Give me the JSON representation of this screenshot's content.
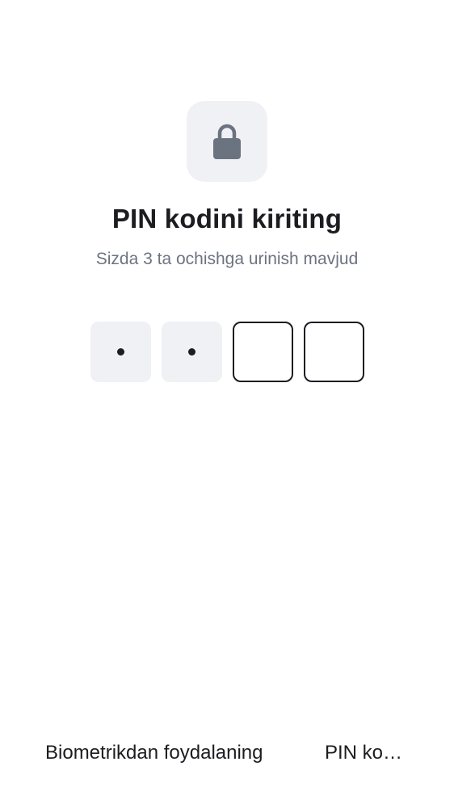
{
  "header": {
    "lock_icon": "lock-icon",
    "title": "PIN kodini kiriting",
    "subtitle": "Sizda 3 ta ochishga urinish mavjud"
  },
  "pin": {
    "length": 4,
    "entered": 2,
    "dot_char": "•"
  },
  "footer": {
    "biometric_label": "Biometrikdan foydalaning",
    "pin_label": "PIN ko…"
  },
  "colors": {
    "tile_bg": "#f0f1f5",
    "icon": "#6c7380",
    "text": "#1c1c21",
    "subtitle": "#6c7380"
  }
}
